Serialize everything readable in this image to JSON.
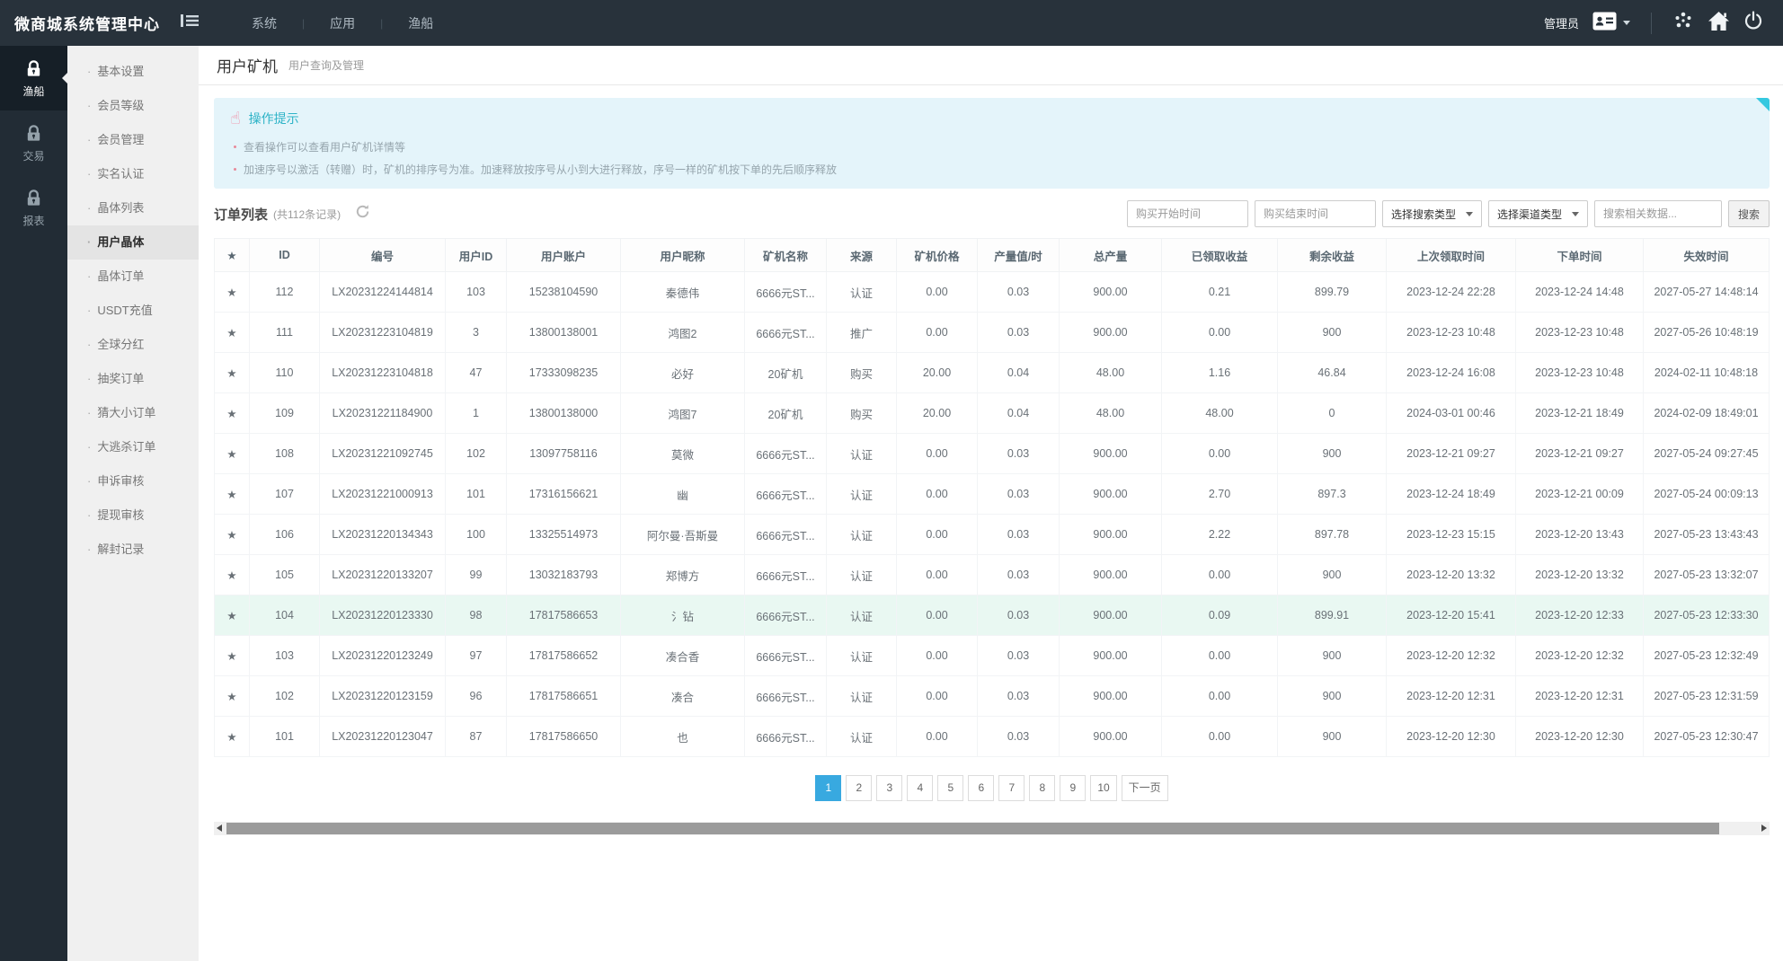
{
  "colors": {
    "navbar_bg": "#28323b",
    "accent_blue": "#38a9e0",
    "alert_bg": "#e4f4fa",
    "alert_title": "#2db3c7",
    "highlight_row": "#e9f8f2",
    "corner_fold": "#35c8e0"
  },
  "navbar": {
    "brand": "微商城系统管理中心",
    "menu": [
      {
        "label": "系统"
      },
      {
        "label": "应用"
      },
      {
        "label": "渔船"
      }
    ],
    "admin_label": "管理员"
  },
  "sidebar": {
    "rail": [
      {
        "label": "渔船",
        "active": true
      },
      {
        "label": "交易",
        "active": false
      },
      {
        "label": "报表",
        "active": false
      }
    ],
    "menu": [
      "基本设置",
      "会员等级",
      "会员管理",
      "实名认证",
      "晶体列表",
      "用户晶体",
      "晶体订单",
      "USDT充值",
      "全球分红",
      "抽奖订单",
      "猜大小订单",
      "大逃杀订单",
      "申诉审核",
      "提现审核",
      "解封记录"
    ],
    "active_item": "用户晶体"
  },
  "page": {
    "title": "用户矿机",
    "subtitle": "用户查询及管理"
  },
  "alert": {
    "title": "操作提示",
    "lines": [
      "查看操作可以查看用户矿机详情等",
      "加速序号以激活（转赠）时，矿机的排序号为准。加速释放按序号从小到大进行释放，序号一样的矿机按下单的先后顺序释放"
    ]
  },
  "list": {
    "title": "订单列表",
    "count_note": "(共112条记录)",
    "filters": {
      "start_placeholder": "购买开始时间",
      "end_placeholder": "购买结束时间",
      "search_type": "选择搜索类型",
      "channel_type": "选择渠道类型",
      "keyword_placeholder": "搜索相关数据...",
      "search_button": "搜索"
    }
  },
  "table": {
    "headers": [
      "ID",
      "编号",
      "用户ID",
      "用户账户",
      "用户昵称",
      "矿机名称",
      "来源",
      "矿机价格",
      "产量值/时",
      "总产量",
      "已领取收益",
      "剩余收益",
      "上次领取时间",
      "下单时间",
      "失效时间"
    ],
    "highlighted_id": "104",
    "rows": [
      [
        "112",
        "LX20231224144814",
        "103",
        "15238104590",
        "秦德伟",
        "6666元ST...",
        "认证",
        "0.00",
        "0.03",
        "900.00",
        "0.21",
        "899.79",
        "2023-12-24 22:28",
        "2023-12-24 14:48",
        "2027-05-27 14:48:14"
      ],
      [
        "111",
        "LX20231223104819",
        "3",
        "13800138001",
        "鸿图2",
        "6666元ST...",
        "推广",
        "0.00",
        "0.03",
        "900.00",
        "0.00",
        "900",
        "2023-12-23 10:48",
        "2023-12-23 10:48",
        "2027-05-26 10:48:19"
      ],
      [
        "110",
        "LX20231223104818",
        "47",
        "17333098235",
        "必好",
        "20矿机",
        "购买",
        "20.00",
        "0.04",
        "48.00",
        "1.16",
        "46.84",
        "2023-12-24 16:08",
        "2023-12-23 10:48",
        "2024-02-11 10:48:18"
      ],
      [
        "109",
        "LX20231221184900",
        "1",
        "13800138000",
        "鸿图7",
        "20矿机",
        "购买",
        "20.00",
        "0.04",
        "48.00",
        "48.00",
        "0",
        "2024-03-01 00:46",
        "2023-12-21 18:49",
        "2024-02-09 18:49:01"
      ],
      [
        "108",
        "LX20231221092745",
        "102",
        "13097758116",
        "莫微",
        "6666元ST...",
        "认证",
        "0.00",
        "0.03",
        "900.00",
        "0.00",
        "900",
        "2023-12-21 09:27",
        "2023-12-21 09:27",
        "2027-05-24 09:27:45"
      ],
      [
        "107",
        "LX20231221000913",
        "101",
        "17316156621",
        "幽",
        "6666元ST...",
        "认证",
        "0.00",
        "0.03",
        "900.00",
        "2.70",
        "897.3",
        "2023-12-24 18:49",
        "2023-12-21 00:09",
        "2027-05-24 00:09:13"
      ],
      [
        "106",
        "LX20231220134343",
        "100",
        "13325514973",
        "阿尔曼·吾斯曼",
        "6666元ST...",
        "认证",
        "0.00",
        "0.03",
        "900.00",
        "2.22",
        "897.78",
        "2023-12-23 15:15",
        "2023-12-20 13:43",
        "2027-05-23 13:43:43"
      ],
      [
        "105",
        "LX20231220133207",
        "99",
        "13032183793",
        "郑博方",
        "6666元ST...",
        "认证",
        "0.00",
        "0.03",
        "900.00",
        "0.00",
        "900",
        "2023-12-20 13:32",
        "2023-12-20 13:32",
        "2027-05-23 13:32:07"
      ],
      [
        "104",
        "LX20231220123330",
        "98",
        "17817586653",
        "氵钻",
        "6666元ST...",
        "认证",
        "0.00",
        "0.03",
        "900.00",
        "0.09",
        "899.91",
        "2023-12-20 15:41",
        "2023-12-20 12:33",
        "2027-05-23 12:33:30"
      ],
      [
        "103",
        "LX20231220123249",
        "97",
        "17817586652",
        "凑合香",
        "6666元ST...",
        "认证",
        "0.00",
        "0.03",
        "900.00",
        "0.00",
        "900",
        "2023-12-20 12:32",
        "2023-12-20 12:32",
        "2027-05-23 12:32:49"
      ],
      [
        "102",
        "LX20231220123159",
        "96",
        "17817586651",
        "凑合",
        "6666元ST...",
        "认证",
        "0.00",
        "0.03",
        "900.00",
        "0.00",
        "900",
        "2023-12-20 12:31",
        "2023-12-20 12:31",
        "2027-05-23 12:31:59"
      ],
      [
        "101",
        "LX20231220123047",
        "87",
        "17817586650",
        "也",
        "6666元ST...",
        "认证",
        "0.00",
        "0.03",
        "900.00",
        "0.00",
        "900",
        "2023-12-20 12:30",
        "2023-12-20 12:30",
        "2027-05-23 12:30:47"
      ]
    ]
  },
  "pagination": {
    "pages": [
      "1",
      "2",
      "3",
      "4",
      "5",
      "6",
      "7",
      "8",
      "9",
      "10"
    ],
    "active": "1",
    "next_label": "下一页"
  }
}
